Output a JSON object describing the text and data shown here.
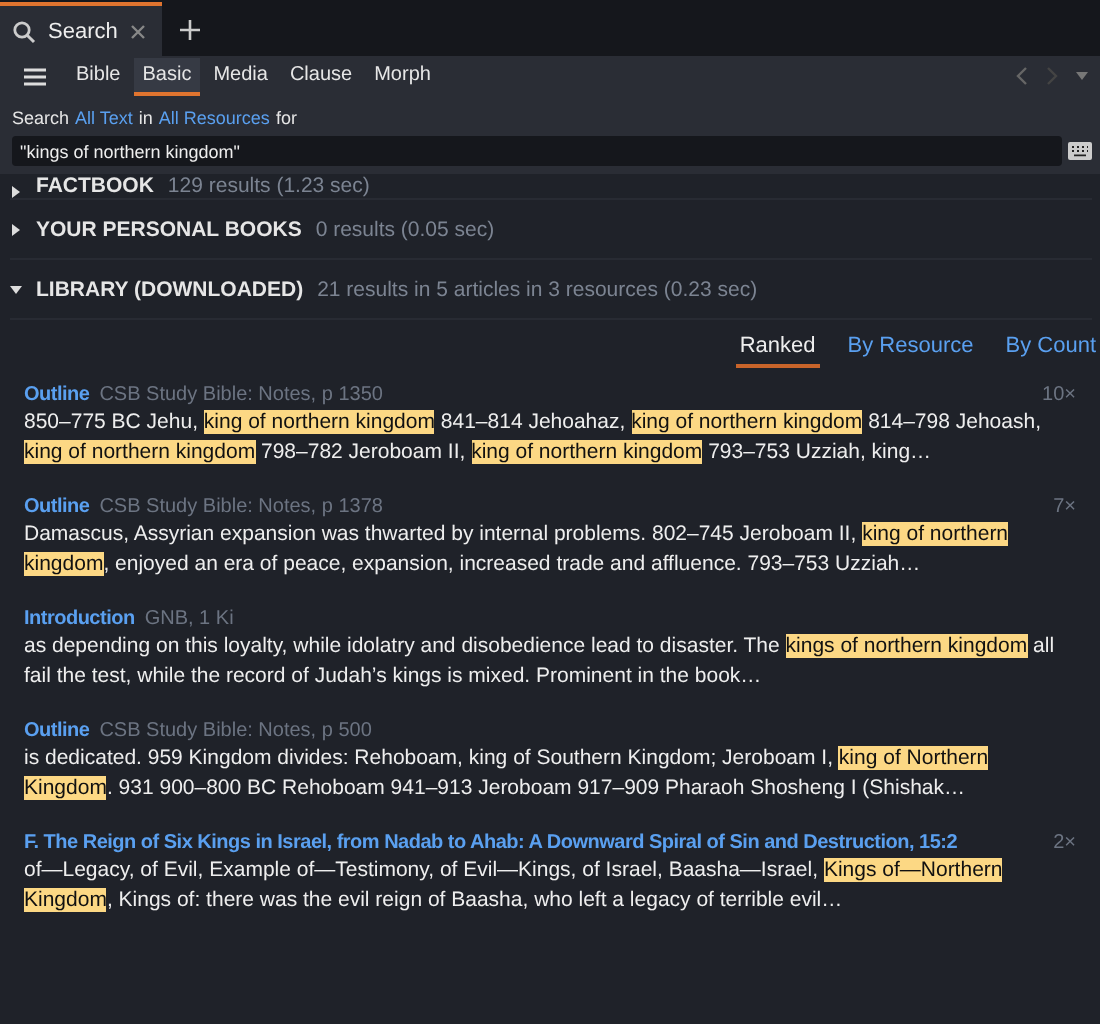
{
  "tab": {
    "title": "Search"
  },
  "search_types": [
    {
      "label": "Bible",
      "selected": false
    },
    {
      "label": "Basic",
      "selected": true
    },
    {
      "label": "Media",
      "selected": false
    },
    {
      "label": "Clause",
      "selected": false
    },
    {
      "label": "Morph",
      "selected": false
    }
  ],
  "scope": [
    {
      "kind": "text",
      "text": "Search"
    },
    {
      "kind": "link",
      "text": "All Text"
    },
    {
      "kind": "text",
      "text": "in"
    },
    {
      "kind": "link",
      "text": "All Resources"
    },
    {
      "kind": "text",
      "text": "for"
    }
  ],
  "query": {
    "value": "\"kings of northern kingdom\""
  },
  "sections": [
    {
      "title": "FACTBOOK",
      "summary": "129 results (1.23 sec)",
      "expanded": false
    },
    {
      "title": "YOUR PERSONAL BOOKS",
      "summary": "0 results (0.05 sec)",
      "expanded": false
    },
    {
      "title": "LIBRARY (DOWNLOADED)",
      "summary": "21 results in 5 articles in 3 resources (0.23 sec)",
      "expanded": true
    }
  ],
  "sort_tabs": [
    {
      "label": "Ranked",
      "selected": true
    },
    {
      "label": "By Resource",
      "selected": false
    },
    {
      "label": "By Count",
      "selected": false
    }
  ],
  "results": [
    {
      "heading": "Outline",
      "source": "CSB Study Bible: Notes, p 1350",
      "count": "10×",
      "snippet": [
        {
          "text": "850–775 BC Jehu, ",
          "highlighted": false
        },
        {
          "text": "king of northern kingdom",
          "highlighted": true
        },
        {
          "text": " 841–814 Jehoahaz, ",
          "highlighted": false
        },
        {
          "text": "king of northern kingdom",
          "highlighted": true
        },
        {
          "text": " 814–798 Jehoash, ",
          "highlighted": false
        },
        {
          "text": "king of northern kingdom",
          "highlighted": true
        },
        {
          "text": " 798–782 Jeroboam II, ",
          "highlighted": false
        },
        {
          "text": "king of northern kingdom",
          "highlighted": true
        },
        {
          "text": " 793–753 Uzziah, king…",
          "highlighted": false
        }
      ]
    },
    {
      "heading": "Outline",
      "source": "CSB Study Bible: Notes, p 1378",
      "count": "7×",
      "snippet": [
        {
          "text": "Damascus, Assyrian expansion was thwarted by internal problems. 802–745 Jeroboam II, ",
          "highlighted": false
        },
        {
          "text": "king of northern kingdom",
          "highlighted": true
        },
        {
          "text": ", enjoyed an era of peace, expansion, increased trade and affluence. 793–753 Uzziah…",
          "highlighted": false
        }
      ]
    },
    {
      "heading": "Introduction",
      "source": "GNB, 1 Ki",
      "snippet": [
        {
          "text": "as depending on this loyalty, while idolatry and disobedience lead to disaster. The ",
          "highlighted": false
        },
        {
          "text": "kings of northern kingdom",
          "highlighted": true
        },
        {
          "text": " all fail the test, while the record of Judah’s kings is mixed. Prominent in the book…",
          "highlighted": false
        }
      ]
    },
    {
      "heading": "Outline",
      "source": "CSB Study Bible: Notes, p 500",
      "snippet": [
        {
          "text": "is dedicated. 959 Kingdom divides: Rehoboam, king of Southern Kingdom; Jeroboam I, ",
          "highlighted": false
        },
        {
          "text": "king of Northern Kingdom",
          "highlighted": true
        },
        {
          "text": ". 931 900–800 BC Rehoboam 941–913 Jeroboam 917–909 Pharaoh Shosheng I (Shishak…",
          "highlighted": false
        }
      ]
    },
    {
      "heading": "F. The Reign of Six Kings in Israel, from Nadab to Ahab: A Downward Spiral of Sin and Destruction, 15:2",
      "count": "2×",
      "snippet": [
        {
          "text": "of—Legacy, of Evil, Example of—Testimony, of Evil—Kings, of Israel, Baasha—Israel, ",
          "highlighted": false
        },
        {
          "text": "Kings of—Northern Kingdom",
          "highlighted": true
        },
        {
          "text": ", Kings of: there was the evil reign of Baasha, who left a legacy of terrible evil…",
          "highlighted": false
        }
      ]
    }
  ]
}
